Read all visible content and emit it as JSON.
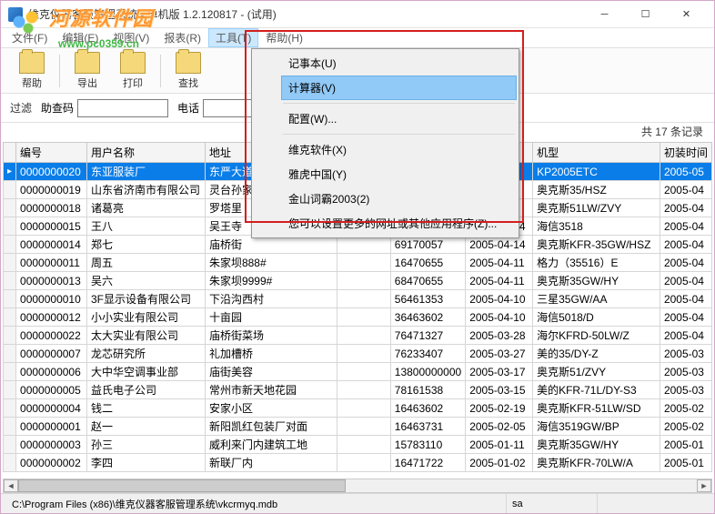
{
  "title": "维克仪器客服管理系统 - 单机版 1.2.120817 - (试用)",
  "watermark": {
    "text": "河源软件园",
    "url": "www.pc0359.cn"
  },
  "menubar": {
    "file": "文件(F)",
    "edit": "编辑(E)",
    "view": "视图(V)",
    "report": "报表(R)",
    "tools": "工具(T)",
    "help": "帮助(H)"
  },
  "dropdown": {
    "notepad": "记事本(U)",
    "calculator": "计算器(V)",
    "config": "配置(W)...",
    "wksoft": "维克软件(X)",
    "yahoo": "雅虎中国(Y)",
    "jinshan": "金山词霸2003(2)",
    "more": "您可以设置更多的网址或其他应用程序(Z)..."
  },
  "toolbar": {
    "help": "帮助",
    "export": "导出",
    "print": "打印",
    "find": "查找"
  },
  "filter": {
    "label": "过滤",
    "code_label": "助查码",
    "phone_label": "电话"
  },
  "records_text": "共 17 条记录",
  "columns": {
    "id": "编号",
    "name": "用户名称",
    "addr": "地址",
    "c4": "",
    "c5": "",
    "c6": "",
    "model": "机型",
    "install": "初装时间"
  },
  "rows": [
    {
      "id": "0000000020",
      "name": "东亚服装厂",
      "addr": "东严大道",
      "c4": "",
      "c5": "",
      "c6": "",
      "model": "KP2005ETC",
      "install": "2005-05"
    },
    {
      "id": "0000000019",
      "name": "山东省济南市有限公司",
      "addr": "灵台孙家",
      "c4": "",
      "c5": "",
      "c6": "",
      "model": "奥克斯35/HSZ",
      "install": "2005-04"
    },
    {
      "id": "0000000018",
      "name": "诸葛亮",
      "addr": "罗塔里",
      "c4": "",
      "c5": "",
      "c6": "",
      "model": "奥克斯51LW/ZVY",
      "install": "2005-04"
    },
    {
      "id": "0000000015",
      "name": "王八",
      "addr": "吴王寺",
      "c4": "",
      "c5": "",
      "c6": "2005-04-14",
      "model": "海信3518",
      "install": "2005-04"
    },
    {
      "id": "0000000014",
      "name": "郑七",
      "addr": "庙桥街",
      "c4": "",
      "c5": "69170057",
      "c6": "2005-04-14",
      "model": "奥克斯KFR-35GW/HSZ",
      "install": "2005-04"
    },
    {
      "id": "0000000011",
      "name": "周五",
      "addr": "朱家坝888#",
      "c4": "",
      "c5": "16470655",
      "c6": "2005-04-11",
      "model": "格力（35516）E",
      "install": "2005-04"
    },
    {
      "id": "0000000013",
      "name": "吴六",
      "addr": "朱家坝9999#",
      "c4": "",
      "c5": "68470655",
      "c6": "2005-04-11",
      "model": "奥克斯35GW/HY",
      "install": "2005-04"
    },
    {
      "id": "0000000010",
      "name": "3F显示设备有限公司",
      "addr": "下沿沟西村",
      "c4": "",
      "c5": "56461353",
      "c6": "2005-04-10",
      "model": "三星35GW/AA",
      "install": "2005-04"
    },
    {
      "id": "0000000012",
      "name": "小小实业有限公司",
      "addr": "十亩园",
      "c4": "",
      "c5": "36463602",
      "c6": "2005-04-10",
      "model": "海信5018/D",
      "install": "2005-04"
    },
    {
      "id": "0000000022",
      "name": "太大实业有限公司",
      "addr": "庙桥街菜场",
      "c4": "",
      "c5": "76471327",
      "c6": "2005-03-28",
      "model": "海尔KFRD-50LW/Z",
      "install": "2005-04"
    },
    {
      "id": "0000000007",
      "name": "龙芯研究所",
      "addr": "礼加槽桥",
      "c4": "",
      "c5": "76233407",
      "c6": "2005-03-27",
      "model": "美的35/DY-Z",
      "install": "2005-03"
    },
    {
      "id": "0000000006",
      "name": "大中华空调事业部",
      "addr": "庙街美容",
      "c4": "",
      "c5": "13800000000",
      "c6": "2005-03-17",
      "model": "奥克斯51/ZVY",
      "install": "2005-03"
    },
    {
      "id": "0000000005",
      "name": "益氏电子公司",
      "addr": "常州市新天地花园",
      "c4": "",
      "c5": "78161538",
      "c6": "2005-03-15",
      "model": "美的KFR-71L/DY-S3",
      "install": "2005-03"
    },
    {
      "id": "0000000004",
      "name": "钱二",
      "addr": "安家小区",
      "c4": "",
      "c5": "16463602",
      "c6": "2005-02-19",
      "model": "奥克斯KFR-51LW/SD",
      "install": "2005-02"
    },
    {
      "id": "0000000001",
      "name": "赵一",
      "addr": "新阳凯红包装厂对面",
      "c4": "",
      "c5": "16463731",
      "c6": "2005-02-05",
      "model": "海信3519GW/BP",
      "install": "2005-02"
    },
    {
      "id": "0000000003",
      "name": "孙三",
      "addr": "威利来门内建筑工地",
      "c4": "",
      "c5": "15783110",
      "c6": "2005-01-11",
      "model": "奥克斯35GW/HY",
      "install": "2005-01"
    },
    {
      "id": "0000000002",
      "name": "李四",
      "addr": "新联厂内",
      "c4": "",
      "c5": "16471722",
      "c6": "2005-01-02",
      "model": "奥克斯KFR-70LW/A",
      "install": "2005-01"
    }
  ],
  "status_path": "C:\\Program Files (x86)\\维克仪器客服管理系统\\vkcrmyq.mdb",
  "status_user": "sa"
}
